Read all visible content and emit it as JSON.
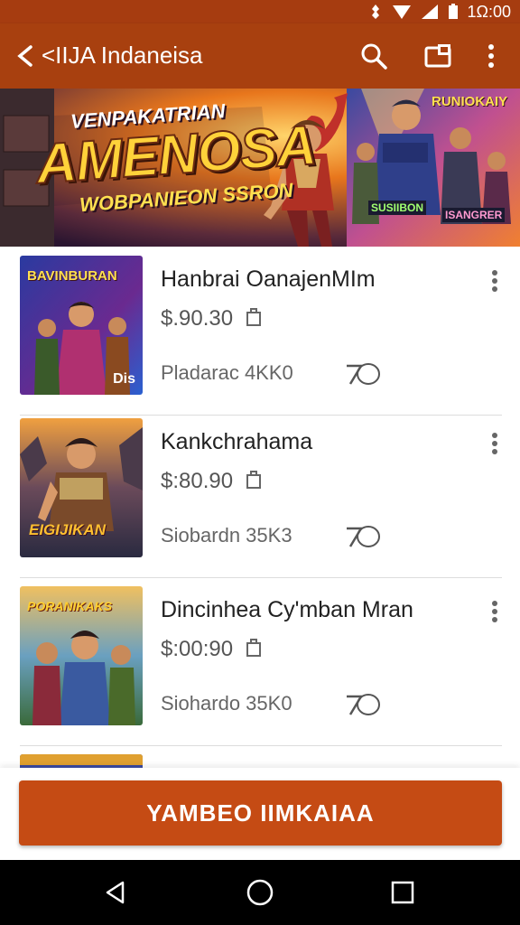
{
  "status_bar": {
    "time": "1Ω:00"
  },
  "app_bar": {
    "title": "<IIJA Indaneisa",
    "icons": [
      "search-icon",
      "cast-icon",
      "more-vert-icon"
    ]
  },
  "banner": {
    "headline_top": "VENPAKATRIAN",
    "headline_main": "AMENOSA",
    "headline_sub": "WOBPANIEON SSRON",
    "side_title": "RUNIOKAIY",
    "side_tag_1": "SUSIIBON",
    "side_tag_2": "ISANGRER"
  },
  "items": [
    {
      "thumb_title": "BAVINBURAN",
      "thumb_tag": "Dis",
      "name": "Hanbrai OanajenMIm",
      "price": "$.90.30",
      "stat": "Pladarac 4KK0",
      "badge": "7O"
    },
    {
      "thumb_title": "EIGIJIKAN",
      "thumb_tag": "",
      "name": "Kankchrahama",
      "price": "$:80.90",
      "stat": "Siobardn 35K3",
      "badge": "7O"
    },
    {
      "thumb_title": "PORANIKAKS",
      "thumb_tag": "",
      "name": "Dincinhea Cy'mban Mran",
      "price": "$:00:90",
      "stat": "Siohardo 35K0",
      "badge": "7O"
    },
    {
      "thumb_title": "",
      "thumb_tag": "",
      "name": "",
      "price": "",
      "stat": "",
      "badge": ""
    }
  ],
  "cta": {
    "label": "YAMBEO IIMKAIAA"
  },
  "nav_bar": {
    "icons": [
      "back-triangle-icon",
      "home-circle-icon",
      "recents-square-icon"
    ]
  },
  "colors": {
    "status_bar": "#a63c10",
    "app_bar": "#a8400f",
    "cta": "#c54b14",
    "nav_bar": "#000000"
  }
}
